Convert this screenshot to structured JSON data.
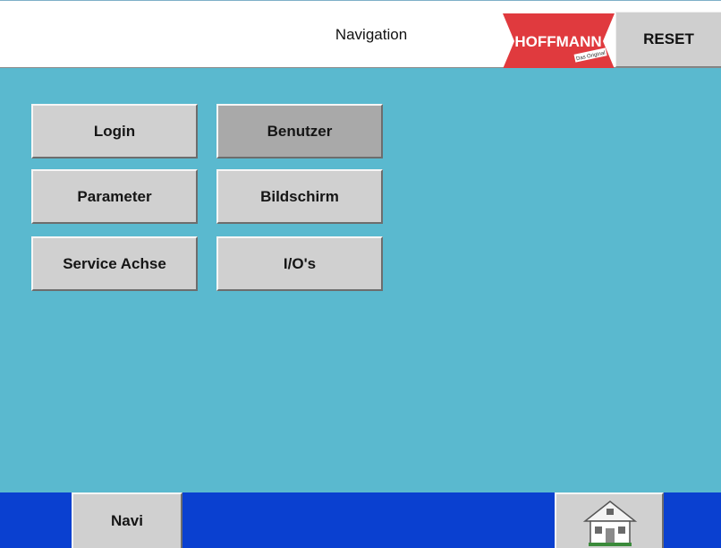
{
  "header": {
    "title": "Navigation",
    "logo_text": "HOFFMANN",
    "logo_tagline": "Das Original",
    "reset_label": "RESET"
  },
  "menu": {
    "buttons": [
      {
        "label": "Login",
        "active": false
      },
      {
        "label": "Benutzer",
        "active": true
      },
      {
        "label": "Parameter",
        "active": false
      },
      {
        "label": "Bildschirm",
        "active": false
      },
      {
        "label": "Service Achse",
        "active": false
      },
      {
        "label": "I/O's",
        "active": false
      }
    ]
  },
  "footer": {
    "navi_label": "Navi",
    "home_icon": "home-icon"
  },
  "colors": {
    "header_bg": "#ffffff",
    "main_bg": "#5ab9cf",
    "footer_bg": "#0a40d0",
    "button_bg": "#d0d0d0",
    "button_active_bg": "#a9a9a9",
    "logo_red": "#e03a3e"
  }
}
